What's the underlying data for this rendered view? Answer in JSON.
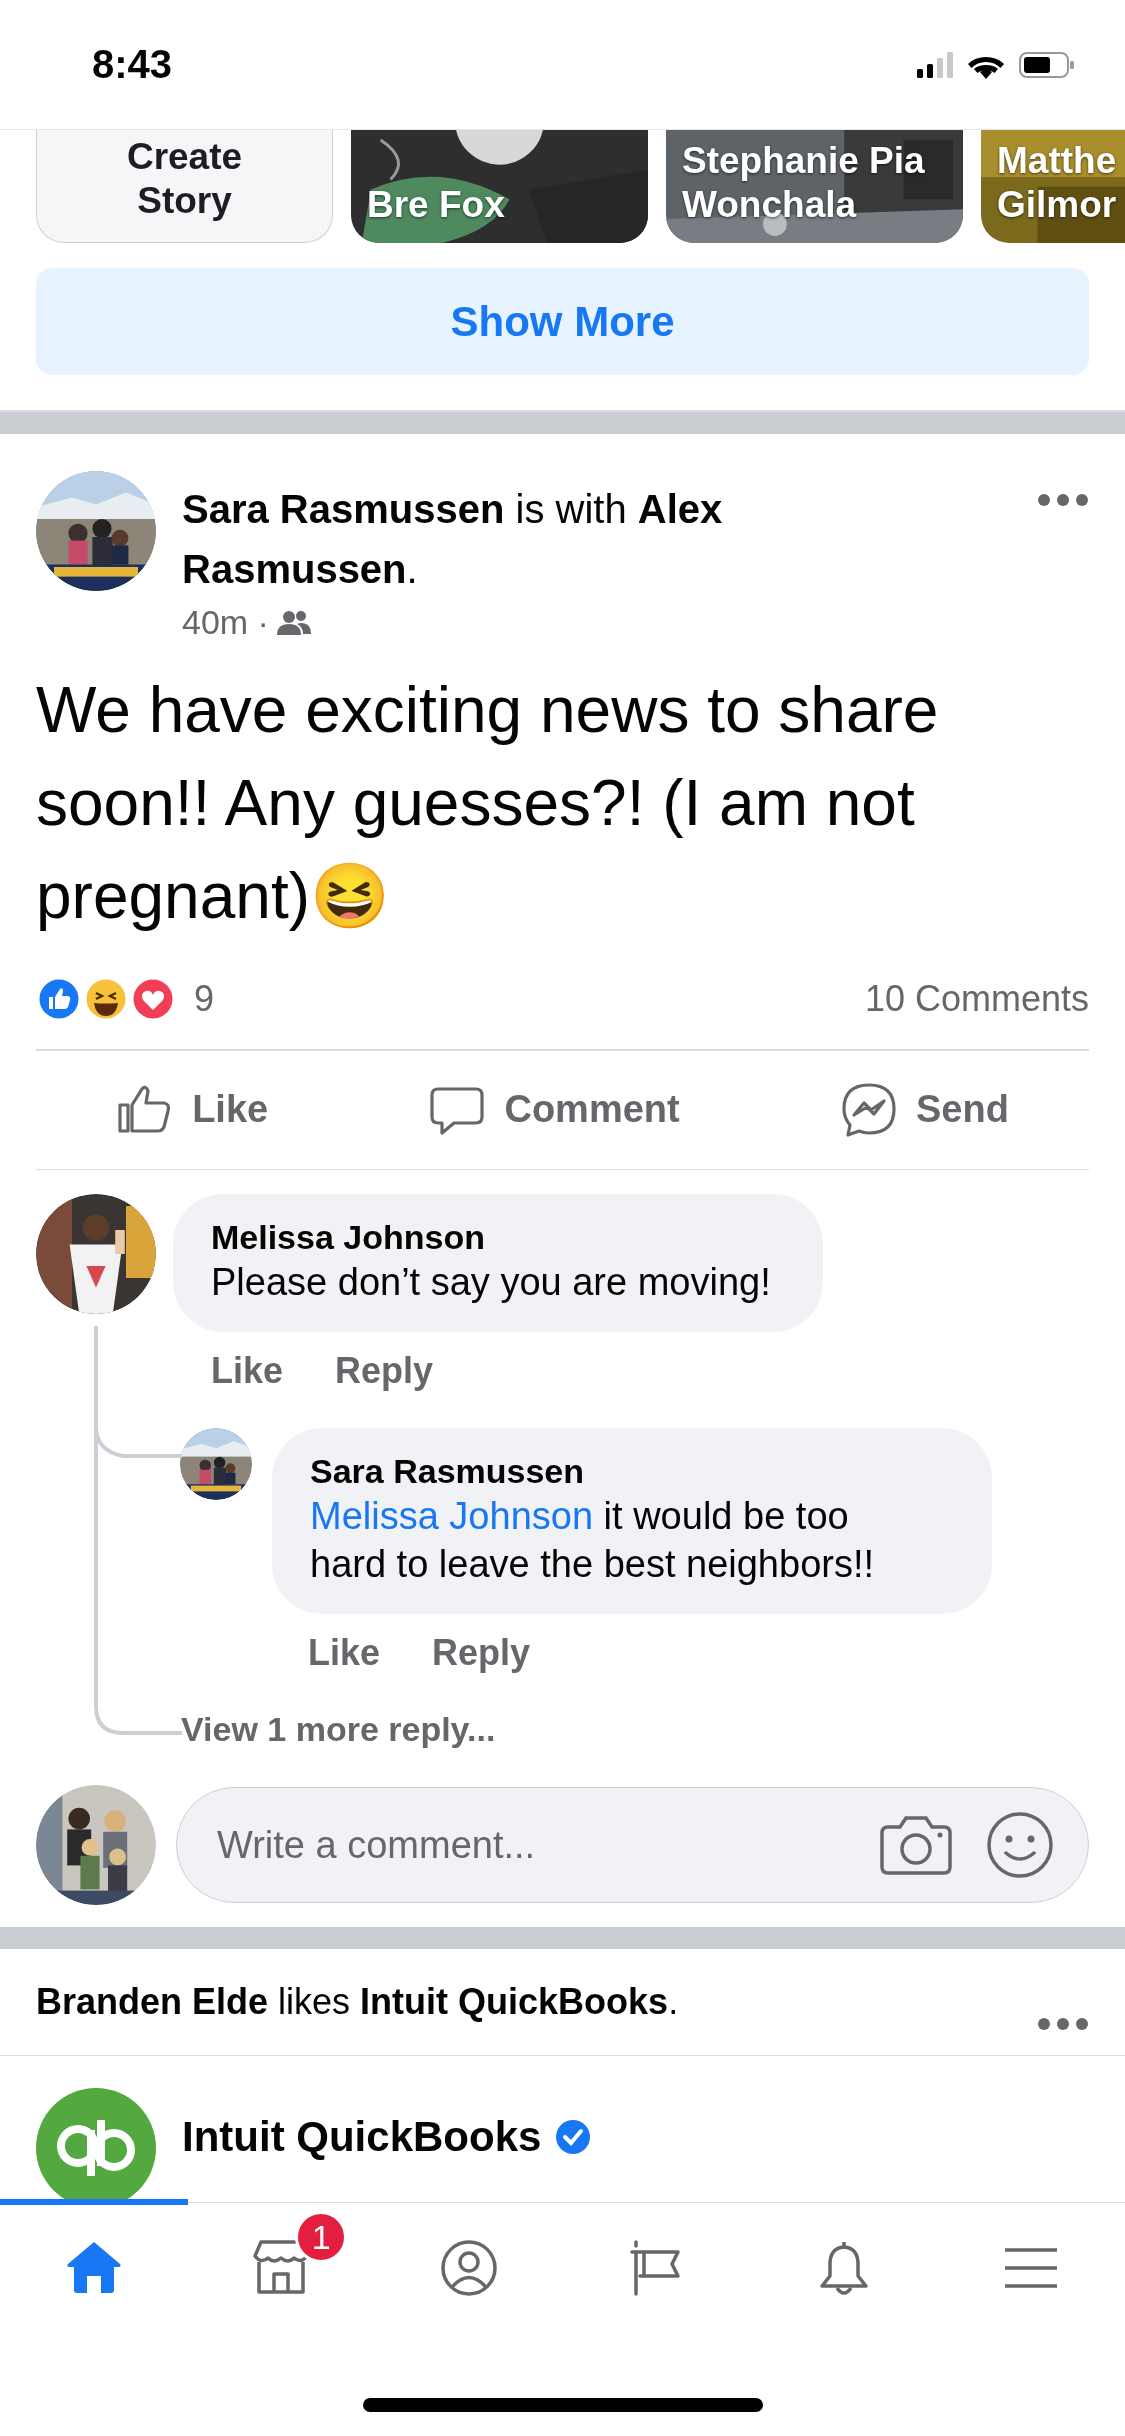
{
  "status_bar": {
    "time": "8:43"
  },
  "stories": [
    {
      "kind": "create",
      "label": "Create Story"
    },
    {
      "kind": "story",
      "name": "Bre Fox"
    },
    {
      "kind": "story",
      "name": "Stephanie Pia Wonchala"
    },
    {
      "kind": "story",
      "name": "Matthe Gilmor"
    }
  ],
  "show_more": "Show More",
  "post": {
    "headline": "**Sara Rasmussen** is with **Alex Rasmussen**.",
    "time": "40m ·",
    "text": "We have exciting news to share soon!! Any guesses?! (I am not pregnant)😆",
    "reaction_count": "9",
    "comments_count": "10 Comments",
    "actions": [
      {
        "kind": "like",
        "label": "Like"
      },
      {
        "kind": "comment",
        "label": "Comment"
      },
      {
        "kind": "send",
        "label": "Send"
      }
    ],
    "comments": [
      {
        "author": "Melissa Johnson",
        "text": "Please don’t say you are moving!",
        "actions": [
          "Like",
          "Reply"
        ],
        "replies": [
          {
            "author": "Sara Rasmussen",
            "mention": "Melissa Johnson",
            "text": "it would be too hard to leave the best neighbors!!",
            "actions": [
              "Like",
              "Reply"
            ]
          }
        ],
        "more_replies": "View 1 more reply..."
      }
    ],
    "composer": {
      "placeholder": "Write a comment..."
    }
  },
  "suggested": {
    "context": "**Branden Elde** likes **Intuit QuickBooks**.",
    "page_name": "Intuit QuickBooks",
    "verified": true
  },
  "tab_bar": [
    {
      "kind": "home",
      "selected": true
    },
    {
      "kind": "marketplace",
      "selected": false,
      "badge": "1"
    },
    {
      "kind": "profile",
      "selected": false
    },
    {
      "kind": "pages",
      "selected": false
    },
    {
      "kind": "notifications",
      "selected": false
    },
    {
      "kind": "menu",
      "selected": false
    }
  ]
}
